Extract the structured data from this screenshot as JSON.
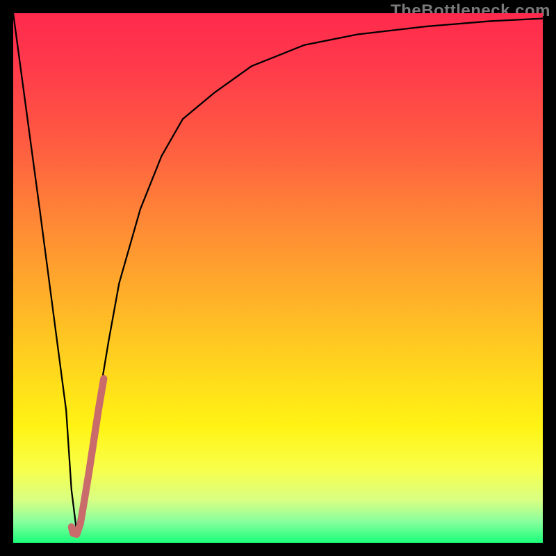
{
  "watermark": "TheBottleneck.com",
  "chart_data": {
    "type": "line",
    "title": "",
    "xlabel": "",
    "ylabel": "",
    "xlim": [
      0,
      100
    ],
    "ylim": [
      0,
      100
    ],
    "series": [
      {
        "name": "curve-black",
        "color": "#000000",
        "stroke_width": 2,
        "x": [
          0,
          5,
          10,
          11,
          12,
          13,
          14,
          16,
          18,
          20,
          24,
          28,
          32,
          38,
          45,
          55,
          65,
          78,
          90,
          100
        ],
        "y": [
          100,
          63,
          25,
          10,
          2,
          5,
          12,
          26,
          38,
          49,
          63,
          73,
          80,
          85,
          90,
          94,
          96,
          97.5,
          98.5,
          99
        ]
      },
      {
        "name": "segment-pink",
        "color": "#c96b6b",
        "stroke_width": 10,
        "x": [
          11.0,
          11.3,
          12.0,
          12.7,
          13.4,
          14.3,
          15.2,
          16.1,
          17.1
        ],
        "y": [
          3.0,
          1.8,
          1.6,
          3.7,
          7.8,
          13.3,
          19.2,
          25.1,
          31.0
        ]
      }
    ]
  }
}
